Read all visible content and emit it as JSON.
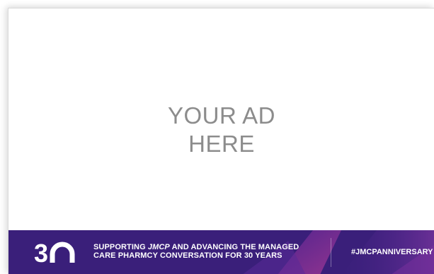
{
  "ad": {
    "placeholder_line1": "YOUR AD",
    "placeholder_line2": "HERE"
  },
  "banner": {
    "logo_text": "30",
    "tagline_prefix": "SUPPORTING ",
    "tagline_journal": "JMCP",
    "tagline_line1_suffix": " AND ADVANCING THE MANAGED",
    "tagline_line2": "CARE PHARMCY CONVERSATION FOR 30 YEARS",
    "hashtag": "#JMCPANNIVERSARY"
  },
  "colors": {
    "banner_background": "#3a1f7a",
    "banner_accent": "#7a2f9e",
    "banner_highlight": "#c23f9a",
    "placeholder_text": "#8c8c8c"
  }
}
